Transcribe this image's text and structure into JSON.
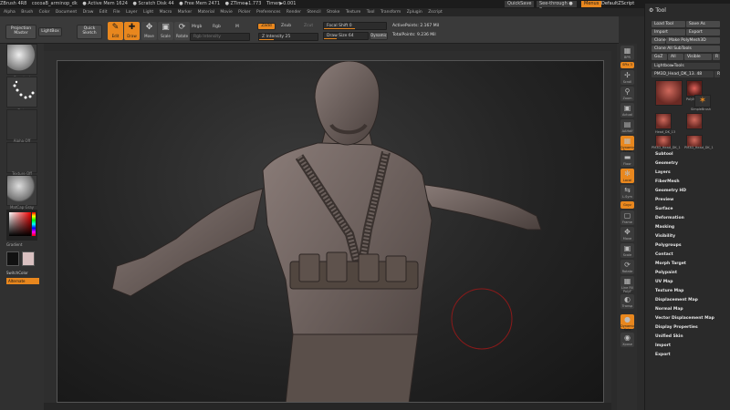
{
  "titlebar": {
    "items": [
      "ZBrush 4R8",
      "cocoaB_arminop_dk",
      "● Active Mem 1624",
      "● Scratch Disk 44",
      "● Free Mem 2471",
      "● ZTime◈1.773",
      "Timer▶0.001"
    ],
    "quicksave": "QuickSave",
    "seethrough": "See-through ● 0",
    "menus": "Menus",
    "defaultscript": "DefaultZScript"
  },
  "menubar": [
    "Alpha",
    "Brush",
    "Color",
    "Document",
    "Draw",
    "Edit",
    "File",
    "Layer",
    "Light",
    "Macro",
    "Marker",
    "Material",
    "Movie",
    "Picker",
    "Preferences",
    "Render",
    "Stencil",
    "Stroke",
    "Texture",
    "Tool",
    "Transform",
    "Zplugin",
    "Zscript"
  ],
  "shelf": {
    "projection_master": "Projection Master",
    "lightbox": "LightBox",
    "quick_sketch": "Quick Sketch",
    "edit": "Edit",
    "draw": "Draw",
    "move": "Move",
    "scale": "Scale",
    "rotate": "Rotate",
    "mrgb": "Mrgb",
    "rgb": "Rgb",
    "m": "M",
    "zadd": "Zadd",
    "zsub": "Zsub",
    "zcut": "Zcut",
    "rgb_intensity": "Rgb Intensity",
    "z_intensity": "Z Intensity 25",
    "focal_shift": "Focal Shift 0",
    "draw_size": "Draw Size 64",
    "dynamic": "Dynamic",
    "active_points": "ActivePoints: 2.167 Mil",
    "total_points": "TotalPoints: 9.236 Mil"
  },
  "lefttray": {
    "brush": "Standard",
    "stroke": "Dots",
    "alpha": "Alpha Off",
    "texture": "Texture Off",
    "material": "MatCap Gray",
    "gradient": "Gradient",
    "switchcolor": "SwitchColor",
    "alternate": "Alternate"
  },
  "rightcol": [
    "BPR",
    "SPix 3",
    "Scroll",
    "Zoom",
    "Actual",
    "AAHalf",
    "Dynamic Persp",
    "Floor",
    "Local",
    "L.Sym",
    "Gxyz",
    "Frame",
    "Move",
    "Scale",
    "Rotate",
    "Line Fill PolyF",
    "Transp",
    "Dynamic Solo",
    "Xpose"
  ],
  "toolpanel": {
    "title": "Tool",
    "load_tool": "Load Tool",
    "save_as": "Save As",
    "import": "Import",
    "export": "Export",
    "clone": "Clone",
    "make_polymesh": "Make PolyMesh3D",
    "clone_all": "Clone All SubTools",
    "goz": "GoZ",
    "all": "All",
    "visible": "Visible",
    "r": "R",
    "lightbox_tools": "Lightbox▸Tools",
    "current_tool": "PM3D_Head_DK_13. 48",
    "thumbs": [
      "PM3D_Head",
      "PolyMesh3D",
      "SimpleBrush",
      "Head_DK_13",
      "PM3D_Head_DK_1",
      "PM3D_Head_DK_1"
    ],
    "menu": [
      "Subtool",
      "Geometry",
      "Layers",
      "FiberMesh",
      "Geometry HD",
      "Preview",
      "Surface",
      "Deformation",
      "Masking",
      "Visibility",
      "Polygroups",
      "Contact",
      "Morph Target",
      "Polypaint",
      "UV Map",
      "Texture Map",
      "Displacement Map",
      "Normal Map",
      "Vector Displacement Map",
      "Display Properties",
      "Unified Skin",
      "Import",
      "Export"
    ]
  },
  "colors": {
    "accent": "#e8871e",
    "background": "#2b2b2b",
    "brush_circle": "#8a1a1a",
    "main_color": "#ffffff",
    "secondary_color": "#d9c0c0"
  }
}
